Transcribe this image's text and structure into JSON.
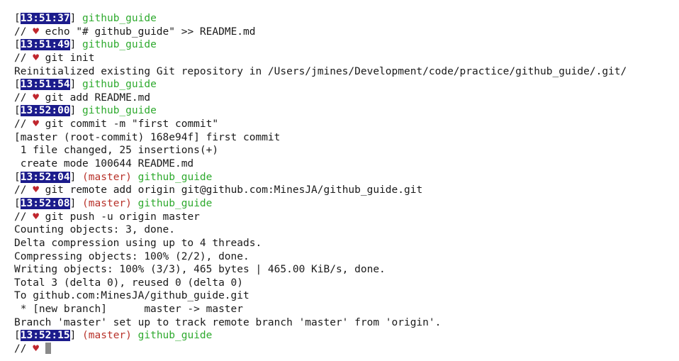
{
  "prompt": {
    "slashes": "//",
    "heart": "♥",
    "dir": "github_guide",
    "branch": "(master)"
  },
  "lines": [
    {
      "type": "info",
      "time": "13:51:37",
      "dir": "github_guide"
    },
    {
      "type": "cmd",
      "text": "echo \"# github_guide\" >> README.md"
    },
    {
      "type": "info",
      "time": "13:51:49",
      "dir": "github_guide"
    },
    {
      "type": "cmd",
      "text": "git init"
    },
    {
      "type": "out",
      "text": "Reinitialized existing Git repository in /Users/jmines/Development/code/practice/github_guide/.git/"
    },
    {
      "type": "info",
      "time": "13:51:54",
      "dir": "github_guide"
    },
    {
      "type": "cmd",
      "text": "git add README.md"
    },
    {
      "type": "info",
      "time": "13:52:00",
      "dir": "github_guide"
    },
    {
      "type": "cmd",
      "text": "git commit -m \"first commit\""
    },
    {
      "type": "out",
      "text": "[master (root-commit) 168e94f] first commit"
    },
    {
      "type": "out",
      "text": " 1 file changed, 25 insertions(+)"
    },
    {
      "type": "out",
      "text": " create mode 100644 README.md"
    },
    {
      "type": "info",
      "time": "13:52:04",
      "branch": "(master)",
      "dir": "github_guide"
    },
    {
      "type": "cmd",
      "text": "git remote add origin git@github.com:MinesJA/github_guide.git"
    },
    {
      "type": "info",
      "time": "13:52:08",
      "branch": "(master)",
      "dir": "github_guide"
    },
    {
      "type": "cmd",
      "text": "git push -u origin master"
    },
    {
      "type": "out",
      "text": "Counting objects: 3, done."
    },
    {
      "type": "out",
      "text": "Delta compression using up to 4 threads."
    },
    {
      "type": "out",
      "text": "Compressing objects: 100% (2/2), done."
    },
    {
      "type": "out",
      "text": "Writing objects: 100% (3/3), 465 bytes | 465.00 KiB/s, done."
    },
    {
      "type": "out",
      "text": "Total 3 (delta 0), reused 0 (delta 0)"
    },
    {
      "type": "out",
      "text": "To github.com:MinesJA/github_guide.git"
    },
    {
      "type": "out",
      "text": " * [new branch]      master -> master"
    },
    {
      "type": "out",
      "text": "Branch 'master' set up to track remote branch 'master' from 'origin'."
    },
    {
      "type": "info",
      "time": "13:52:15",
      "branch": "(master)",
      "dir": "github_guide"
    },
    {
      "type": "cmd",
      "text": "",
      "cursor": true
    }
  ],
  "colors": {
    "time_bg": "#1c1c8c",
    "dir": "#2eaa2e",
    "branch": "#b8322a",
    "heart": "#c0262d"
  }
}
